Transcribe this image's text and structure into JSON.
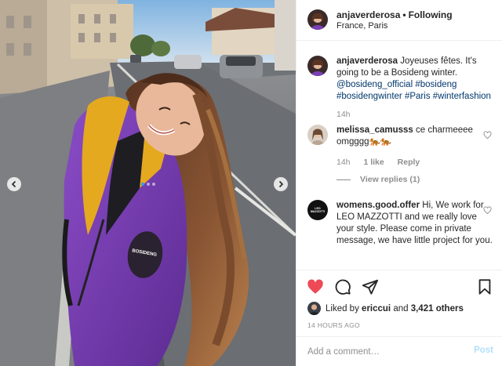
{
  "post": {
    "username": "anjaverderosa",
    "separator": "•",
    "follow_state": "Following",
    "location": "France, Paris"
  },
  "photo": {
    "icons": {
      "prev": "chevron-left-icon",
      "next": "chevron-right-icon"
    },
    "carousel_total": 3,
    "carousel_active": 1,
    "badge_text": "BOSIDENG"
  },
  "caption": {
    "username": "anjaverderosa",
    "text": "Joyeuses fêtes. It's going to be a Bosideng winter.",
    "tags": [
      "@bosideng_official",
      "#bosideng",
      "#bosidengwinter",
      "#Paris",
      "#winterfashion"
    ],
    "time": "14h"
  },
  "comments": [
    {
      "username": "melissa_camusss",
      "text": "ce charmeeee omgggg🐅🐅",
      "time": "14h",
      "likes": "1 like",
      "reply": "Reply",
      "view_replies": "View replies (1)"
    },
    {
      "username": "womens.good.offer",
      "avatar_text": "LEO MAZZOTTI",
      "text": "Hi, We work for LEO MAZZOTTI and we really love your style. Please come in private message, we have little project for you."
    }
  ],
  "actions": {
    "icons": [
      "heart-icon",
      "comment-icon",
      "share-icon",
      "bookmark-icon"
    ],
    "liked_prefix": "Liked by",
    "liked_by": "ericcui",
    "liked_and": "and",
    "liked_count": "3,421 others",
    "timestamp": "14 HOURS AGO"
  },
  "comment_box": {
    "placeholder": "Add a comment…",
    "post_label": "Post"
  },
  "colors": {
    "like_red": "#ed4956",
    "link_blue": "#00376b",
    "post_disabled": "#b2dffc",
    "muted": "#8e8e8e",
    "jacket_purple": "#7b3fb5",
    "jacket_lining": "#e5a91f"
  }
}
